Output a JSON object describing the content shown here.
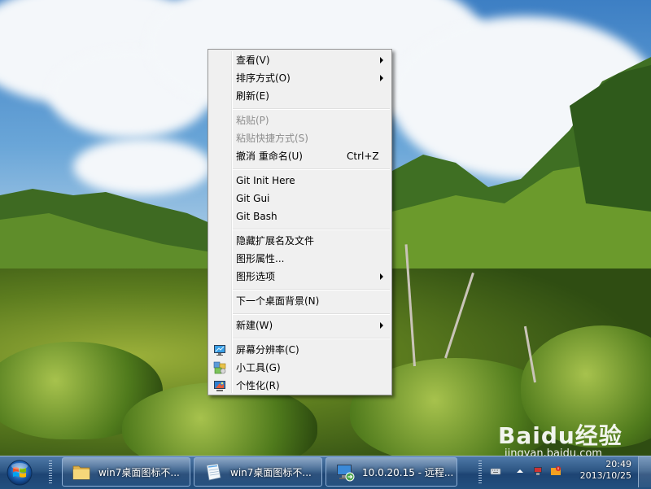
{
  "context_menu": {
    "items": [
      {
        "label": "查看(V)",
        "submenu": true
      },
      {
        "label": "排序方式(O)",
        "submenu": true
      },
      {
        "label": "刷新(E)"
      },
      {
        "label": "粘贴(P)",
        "disabled": true
      },
      {
        "label": "粘贴快捷方式(S)",
        "disabled": true
      },
      {
        "label": "撤消 重命名(U)",
        "shortcut": "Ctrl+Z"
      },
      {
        "label": "Git Init Here"
      },
      {
        "label": "Git Gui"
      },
      {
        "label": "Git Bash"
      },
      {
        "label": "隐藏扩展名及文件"
      },
      {
        "label": "图形属性..."
      },
      {
        "label": "图形选项",
        "submenu": true
      },
      {
        "label": "下一个桌面背景(N)"
      },
      {
        "label": "新建(W)",
        "submenu": true
      },
      {
        "label": "屏幕分辨率(C)",
        "icon": "screen-resolution-icon"
      },
      {
        "label": "小工具(G)",
        "icon": "gadgets-icon"
      },
      {
        "label": "个性化(R)",
        "icon": "personalize-icon"
      }
    ]
  },
  "taskbar": {
    "buttons": [
      {
        "label": "win7桌面图标不...",
        "icon": "folder-icon"
      },
      {
        "label": "win7桌面图标不...",
        "icon": "notepad-icon"
      },
      {
        "label": "10.0.20.15 - 远程...",
        "icon": "remote-desktop-icon"
      }
    ],
    "clock_time": "20:49",
    "clock_date": "2013/10/25"
  },
  "watermark": {
    "main": "Baidu经验",
    "sub": "jingyan.baidu.com"
  },
  "colors": {
    "menu_bg": "#f0f0f0",
    "taskbar": "#2c5583",
    "disabled_text": "#8d8d8d"
  }
}
